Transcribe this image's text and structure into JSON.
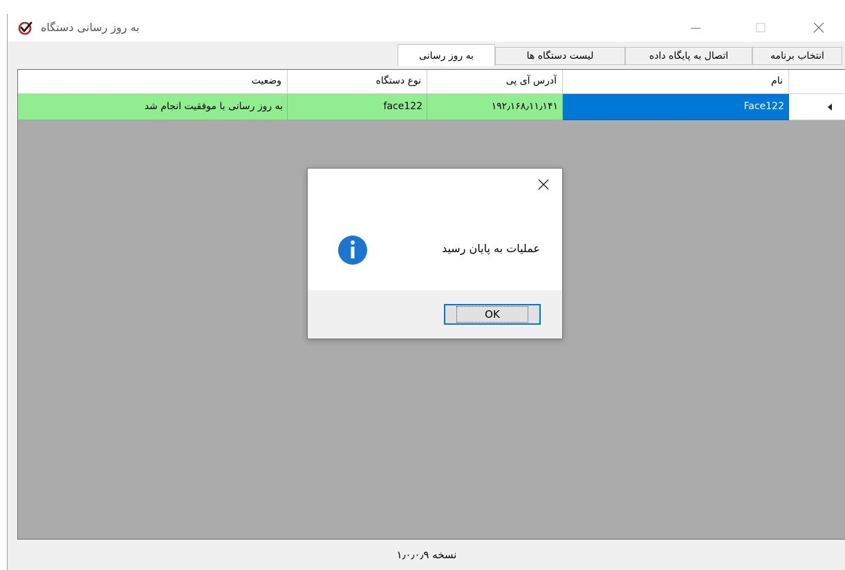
{
  "window": {
    "title": "به روز رسانی دستگاه"
  },
  "tabs": [
    {
      "label": "به روز رسانی",
      "active": true
    },
    {
      "label": "لیست دستگاه ها",
      "active": false
    },
    {
      "label": "اتصال به پایگاه داده",
      "active": false
    },
    {
      "label": "انتخاب برنامه",
      "active": false
    }
  ],
  "grid": {
    "columns": [
      "نام",
      "آدرس آی پی",
      "نوع دستگاه",
      "وضعیت"
    ],
    "rows": [
      {
        "name": "Face122",
        "ip": "۱۹۲٫۱۶۸٫۱۱٫۱۴۱",
        "device_type": "face122",
        "status": "به روز رسانی با موفقیت انجام شد"
      }
    ],
    "row_color": "#90ee90",
    "selected_color": "#0078d7"
  },
  "status_bar": {
    "version": "نسخه ۱٫۰٫۰٫۹"
  },
  "dialog": {
    "message": "عملیات به پایان رسید",
    "ok_label": "OK",
    "icon": "info-icon"
  }
}
